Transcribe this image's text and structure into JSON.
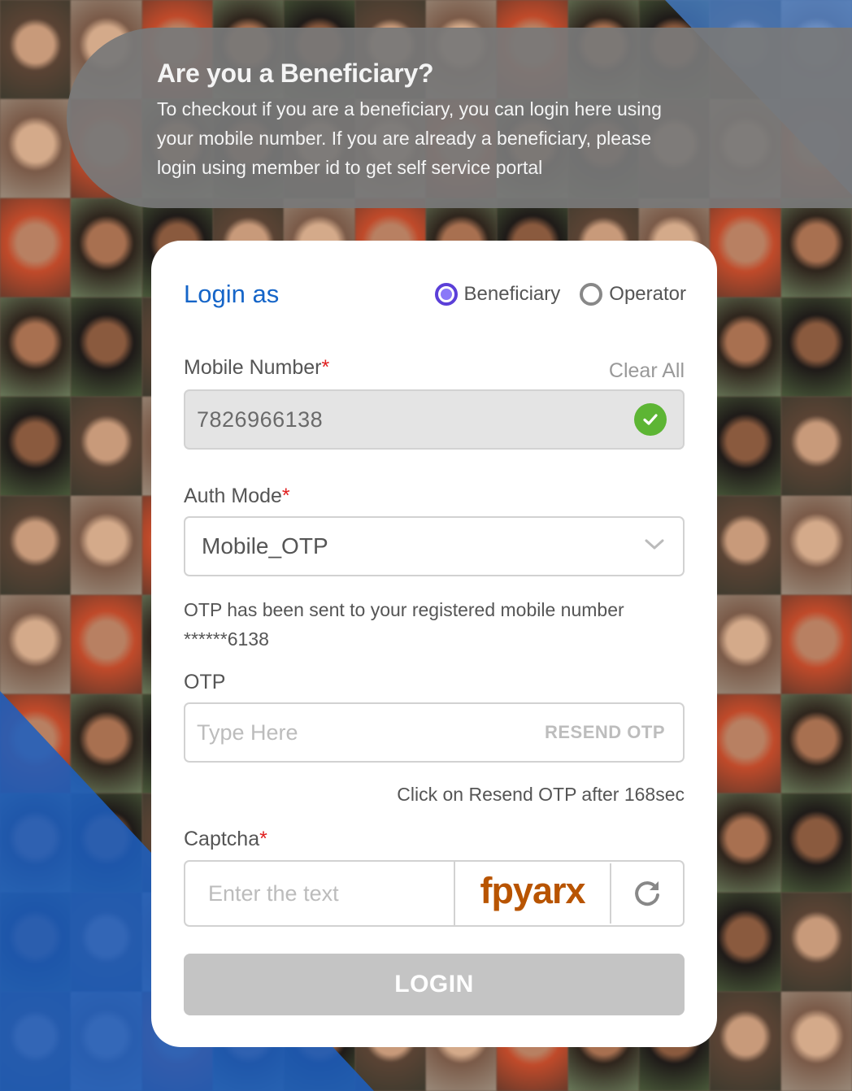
{
  "banner": {
    "title": "Are you a Beneficiary?",
    "description": "To checkout if you are a beneficiary, you can login here using your mobile number. If you are already a beneficiary, please login using member id to get self service portal"
  },
  "login": {
    "title": "Login as",
    "roles": [
      {
        "label": "Beneficiary",
        "selected": true
      },
      {
        "label": "Operator",
        "selected": false
      }
    ]
  },
  "mobile": {
    "label": "Mobile Number",
    "required_mark": "*",
    "clear_all": "Clear All",
    "value": "7826966138",
    "verified_icon": "check-circle-icon"
  },
  "auth_mode": {
    "label": "Auth Mode",
    "required_mark": "*",
    "selected": "Mobile_OTP"
  },
  "otp_message": {
    "line1": "OTP has been sent to your registered mobile number",
    "line2": "******6138"
  },
  "otp": {
    "label": "OTP",
    "value": "",
    "placeholder": "Type Here",
    "resend_label": "RESEND OTP",
    "resend_timer": "Click on Resend OTP after 168sec"
  },
  "captcha": {
    "label": "Captcha",
    "required_mark": "*",
    "value": "",
    "placeholder": "Enter the text",
    "code": "fpyarx",
    "refresh_icon": "refresh-icon"
  },
  "submit": {
    "label": "LOGIN"
  },
  "colors": {
    "accent_blue": "#1565c8",
    "radio_selected": "#5b3fd8",
    "required": "#e02020",
    "verified_green": "#5db534",
    "captcha_text": "#b85400",
    "login_disabled": "#c4c4c4"
  }
}
